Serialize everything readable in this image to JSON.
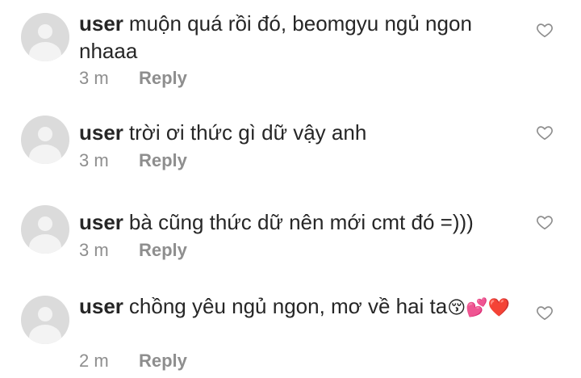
{
  "comments": [
    {
      "username": "user",
      "text": "muộn quá rồi đó, beomgyu ngủ ngon nhaaa",
      "time": "3 m",
      "reply_label": "Reply"
    },
    {
      "username": "user",
      "text": "trời ơi thức gì dữ vậy anh",
      "time": "3 m",
      "reply_label": "Reply"
    },
    {
      "username": "user",
      "text": "bà cũng thức dữ nên mới cmt đó =)))",
      "time": "3 m",
      "reply_label": "Reply"
    },
    {
      "username": "user",
      "text": "chồng yêu ngủ ngon, mơ về hai ta",
      "emoji": "😚💕❤️",
      "time": "2 m",
      "reply_label": "Reply"
    }
  ],
  "icons": {
    "avatar": "default-avatar-icon",
    "like": "heart-outline-icon"
  },
  "colors": {
    "text": "#262626",
    "meta": "#8e8e8e",
    "avatar": "#dbdbdb"
  }
}
